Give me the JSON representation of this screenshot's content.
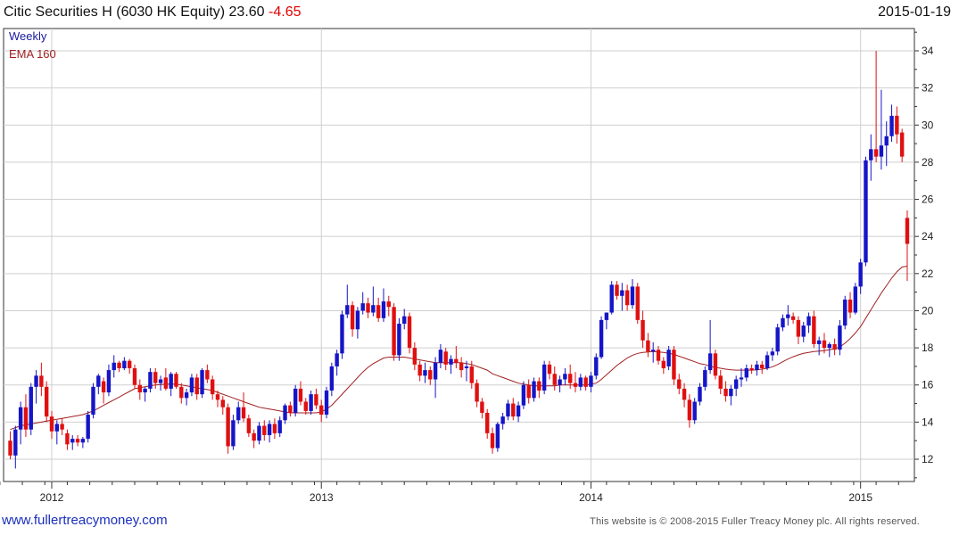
{
  "header": {
    "title": "Citic Securities H (6030 HK  Equity) 23.60",
    "change": "-4.65",
    "date": "2015-01-19"
  },
  "footer": {
    "link": "www.fullertreacymoney.com",
    "copyright": "This website is © 2008-2015 Fuller Treacy Money plc. All rights reserved."
  },
  "colors": {
    "up": "#1515c8",
    "down": "#e01010",
    "ema": "#a02020",
    "grid": "#cfcfcf",
    "axis": "#333333"
  },
  "chart_data": {
    "type": "candlestick",
    "title": "Citic Securities H (6030 HK  Equity) 23.60 -4.65",
    "frequency": "Weekly",
    "legend": [
      "Weekly",
      "EMA 160"
    ],
    "legend_position": "top-left",
    "ylim": [
      10.8,
      35.2
    ],
    "yticks": [
      12,
      14,
      16,
      18,
      20,
      22,
      24,
      26,
      28,
      30,
      32,
      34
    ],
    "y_axis_side": "right",
    "xticks": [
      {
        "label": "2012",
        "week": 8
      },
      {
        "label": "2013",
        "week": 60
      },
      {
        "label": "2014",
        "week": 112
      },
      {
        "label": "2015",
        "week": 164
      }
    ],
    "grid": true,
    "candles": [
      [
        13.0,
        13.5,
        12.0,
        12.2
      ],
      [
        12.2,
        13.8,
        11.5,
        13.6
      ],
      [
        13.6,
        15.1,
        12.8,
        14.8
      ],
      [
        14.8,
        15.5,
        13.2,
        13.6
      ],
      [
        13.6,
        16.1,
        13.3,
        15.9
      ],
      [
        15.9,
        16.8,
        15.0,
        16.5
      ],
      [
        16.5,
        17.2,
        15.4,
        15.9
      ],
      [
        15.9,
        16.2,
        14.0,
        14.3
      ],
      [
        14.3,
        14.6,
        13.1,
        13.5
      ],
      [
        13.5,
        14.1,
        12.8,
        13.9
      ],
      [
        13.9,
        14.2,
        13.3,
        13.6
      ],
      [
        13.4,
        13.6,
        12.5,
        12.8
      ],
      [
        12.9,
        13.3,
        12.5,
        13.1
      ],
      [
        13.1,
        13.3,
        12.7,
        12.9
      ],
      [
        12.9,
        13.2,
        12.6,
        13.1
      ],
      [
        13.1,
        14.6,
        12.9,
        14.4
      ],
      [
        14.4,
        16.1,
        14.2,
        15.9
      ],
      [
        15.9,
        16.6,
        15.5,
        16.5
      ],
      [
        16.2,
        16.4,
        15.0,
        15.6
      ],
      [
        15.6,
        17.1,
        15.4,
        16.8
      ],
      [
        16.8,
        17.6,
        16.4,
        17.2
      ],
      [
        17.2,
        17.3,
        16.7,
        16.9
      ],
      [
        16.9,
        17.5,
        16.8,
        17.3
      ],
      [
        17.3,
        17.4,
        16.6,
        16.9
      ],
      [
        16.9,
        17.1,
        15.8,
        16.0
      ],
      [
        16.0,
        16.3,
        15.2,
        15.6
      ],
      [
        15.6,
        15.9,
        15.1,
        15.8
      ],
      [
        15.8,
        16.9,
        15.6,
        16.7
      ],
      [
        16.7,
        16.9,
        15.8,
        16.1
      ],
      [
        16.1,
        16.5,
        15.7,
        16.3
      ],
      [
        16.4,
        16.9,
        15.7,
        15.8
      ],
      [
        15.8,
        16.7,
        15.4,
        16.6
      ],
      [
        16.6,
        16.7,
        15.8,
        15.9
      ],
      [
        15.9,
        16.1,
        15.0,
        15.3
      ],
      [
        15.3,
        15.8,
        14.9,
        15.6
      ],
      [
        15.6,
        16.6,
        15.4,
        16.4
      ],
      [
        16.4,
        16.6,
        15.2,
        15.5
      ],
      [
        15.5,
        16.9,
        15.3,
        16.8
      ],
      [
        16.8,
        17.1,
        16.1,
        16.3
      ],
      [
        16.3,
        16.5,
        15.2,
        15.5
      ],
      [
        15.5,
        15.7,
        14.8,
        15.2
      ],
      [
        15.2,
        15.4,
        14.4,
        14.8
      ],
      [
        14.8,
        15.0,
        12.3,
        12.7
      ],
      [
        12.7,
        14.4,
        12.5,
        14.1
      ],
      [
        14.1,
        15.1,
        13.9,
        14.8
      ],
      [
        14.8,
        15.6,
        14.0,
        14.2
      ],
      [
        14.2,
        14.4,
        13.2,
        13.4
      ],
      [
        13.4,
        13.6,
        12.6,
        13.0
      ],
      [
        13.0,
        14.0,
        12.8,
        13.8
      ],
      [
        13.8,
        14.1,
        13.0,
        13.3
      ],
      [
        13.3,
        14.1,
        12.9,
        13.9
      ],
      [
        13.9,
        14.2,
        13.1,
        13.4
      ],
      [
        13.4,
        14.3,
        13.2,
        14.1
      ],
      [
        14.1,
        15.0,
        13.9,
        14.9
      ],
      [
        14.9,
        15.1,
        14.3,
        14.5
      ],
      [
        14.5,
        16.0,
        14.3,
        15.8
      ],
      [
        15.8,
        16.2,
        14.9,
        15.1
      ],
      [
        15.1,
        15.3,
        14.4,
        14.6
      ],
      [
        14.6,
        15.7,
        14.4,
        15.5
      ],
      [
        15.5,
        15.8,
        14.7,
        14.9
      ],
      [
        14.9,
        15.2,
        14.0,
        14.4
      ],
      [
        14.4,
        15.9,
        14.2,
        15.7
      ],
      [
        15.7,
        17.2,
        15.4,
        17.0
      ],
      [
        17.0,
        17.9,
        16.5,
        17.7
      ],
      [
        17.7,
        20.0,
        17.4,
        19.8
      ],
      [
        19.8,
        21.4,
        19.6,
        20.3
      ],
      [
        20.3,
        20.5,
        18.6,
        19.0
      ],
      [
        19.0,
        20.2,
        18.5,
        20.0
      ],
      [
        20.0,
        21.0,
        19.8,
        20.4
      ],
      [
        20.4,
        20.7,
        19.6,
        19.9
      ],
      [
        19.9,
        21.3,
        19.7,
        20.3
      ],
      [
        20.3,
        20.7,
        19.4,
        19.6
      ],
      [
        19.6,
        21.2,
        19.4,
        20.5
      ],
      [
        20.5,
        20.8,
        19.7,
        20.2
      ],
      [
        20.2,
        20.4,
        17.3,
        17.6
      ],
      [
        17.6,
        19.6,
        17.3,
        19.3
      ],
      [
        19.3,
        20.1,
        19.0,
        19.7
      ],
      [
        19.7,
        19.9,
        17.7,
        18.0
      ],
      [
        18.0,
        18.3,
        16.8,
        17.1
      ],
      [
        17.1,
        17.3,
        16.2,
        16.5
      ],
      [
        16.5,
        17.2,
        16.1,
        16.8
      ],
      [
        16.8,
        17.0,
        16.0,
        16.3
      ],
      [
        16.3,
        17.5,
        15.3,
        17.2
      ],
      [
        17.2,
        18.2,
        16.9,
        17.9
      ],
      [
        17.8,
        18.0,
        16.8,
        17.1
      ],
      [
        17.1,
        17.6,
        16.6,
        17.4
      ],
      [
        17.4,
        18.1,
        16.9,
        17.2
      ],
      [
        17.2,
        17.5,
        16.4,
        16.8
      ],
      [
        16.9,
        17.3,
        16.2,
        17.0
      ],
      [
        17.0,
        17.3,
        15.8,
        16.1
      ],
      [
        16.1,
        16.3,
        14.8,
        15.1
      ],
      [
        15.1,
        15.3,
        14.2,
        14.5
      ],
      [
        14.5,
        14.7,
        13.1,
        13.4
      ],
      [
        13.4,
        13.7,
        12.3,
        12.6
      ],
      [
        12.6,
        14.0,
        12.4,
        13.9
      ],
      [
        13.9,
        14.5,
        13.6,
        14.3
      ],
      [
        14.3,
        15.2,
        14.1,
        15.0
      ],
      [
        15.0,
        15.3,
        14.1,
        14.3
      ],
      [
        14.3,
        15.1,
        14.0,
        14.9
      ],
      [
        14.9,
        16.2,
        14.7,
        16.0
      ],
      [
        16.0,
        16.3,
        15.0,
        15.3
      ],
      [
        15.3,
        16.4,
        15.1,
        16.2
      ],
      [
        16.2,
        16.4,
        15.3,
        15.7
      ],
      [
        15.7,
        17.3,
        15.5,
        17.1
      ],
      [
        17.1,
        17.3,
        16.3,
        16.6
      ],
      [
        16.6,
        17.0,
        15.7,
        16.0
      ],
      [
        16.0,
        16.5,
        15.6,
        16.3
      ],
      [
        16.3,
        16.9,
        16.0,
        16.6
      ],
      [
        16.6,
        17.1,
        15.8,
        16.1
      ],
      [
        16.1,
        16.7,
        15.6,
        15.9
      ],
      [
        15.9,
        16.6,
        15.7,
        16.4
      ],
      [
        16.4,
        16.5,
        15.7,
        15.9
      ],
      [
        15.9,
        16.7,
        15.6,
        16.5
      ],
      [
        16.5,
        17.7,
        16.3,
        17.5
      ],
      [
        17.5,
        19.7,
        17.4,
        19.5
      ],
      [
        19.5,
        19.9,
        19.0,
        19.9
      ],
      [
        19.9,
        21.6,
        19.8,
        21.4
      ],
      [
        21.4,
        21.6,
        20.6,
        20.8
      ],
      [
        20.8,
        21.5,
        20.0,
        21.1
      ],
      [
        21.1,
        21.4,
        20.0,
        20.3
      ],
      [
        20.3,
        21.7,
        20.1,
        21.3
      ],
      [
        21.3,
        21.5,
        19.3,
        19.5
      ],
      [
        19.5,
        20.0,
        18.0,
        18.4
      ],
      [
        18.4,
        18.8,
        17.5,
        17.8
      ],
      [
        17.8,
        18.3,
        17.2,
        17.9
      ],
      [
        17.9,
        18.1,
        17.1,
        17.3
      ],
      [
        17.3,
        17.5,
        16.6,
        16.9
      ],
      [
        17.0,
        18.1,
        16.8,
        17.9
      ],
      [
        17.9,
        18.1,
        16.0,
        16.3
      ],
      [
        16.3,
        16.6,
        15.5,
        15.8
      ],
      [
        15.8,
        16.1,
        14.8,
        15.2
      ],
      [
        15.2,
        15.5,
        13.7,
        14.1
      ],
      [
        14.1,
        15.3,
        13.9,
        15.1
      ],
      [
        15.1,
        16.1,
        14.9,
        15.9
      ],
      [
        15.9,
        17.0,
        15.7,
        16.8
      ],
      [
        16.8,
        19.5,
        16.6,
        17.7
      ],
      [
        17.7,
        17.9,
        16.3,
        16.5
      ],
      [
        16.5,
        16.8,
        15.5,
        15.8
      ],
      [
        15.8,
        16.2,
        15.1,
        15.4
      ],
      [
        15.4,
        16.0,
        14.9,
        15.8
      ],
      [
        15.8,
        16.5,
        15.4,
        16.3
      ],
      [
        16.3,
        16.9,
        15.9,
        16.4
      ],
      [
        16.4,
        17.1,
        16.2,
        16.9
      ],
      [
        16.9,
        17.1,
        16.6,
        16.8
      ],
      [
        16.8,
        17.3,
        16.5,
        17.1
      ],
      [
        17.1,
        17.3,
        16.6,
        16.9
      ],
      [
        16.9,
        17.8,
        16.8,
        17.6
      ],
      [
        17.6,
        18.0,
        17.3,
        17.8
      ],
      [
        17.8,
        19.3,
        17.6,
        19.1
      ],
      [
        19.1,
        19.8,
        18.9,
        19.6
      ],
      [
        19.6,
        20.3,
        19.2,
        19.8
      ],
      [
        19.7,
        19.9,
        19.3,
        19.5
      ],
      [
        19.5,
        19.7,
        18.2,
        18.6
      ],
      [
        18.6,
        19.4,
        18.3,
        19.2
      ],
      [
        19.2,
        19.9,
        18.8,
        19.7
      ],
      [
        19.7,
        20.0,
        18.0,
        18.2
      ],
      [
        18.2,
        18.6,
        17.6,
        18.4
      ],
      [
        18.4,
        18.8,
        17.7,
        18.0
      ],
      [
        18.0,
        18.3,
        17.5,
        18.2
      ],
      [
        18.2,
        18.5,
        17.6,
        17.9
      ],
      [
        17.9,
        19.5,
        17.6,
        19.2
      ],
      [
        19.2,
        20.8,
        19.0,
        20.6
      ],
      [
        20.6,
        21.0,
        19.6,
        19.9
      ],
      [
        19.9,
        21.5,
        19.8,
        21.3
      ],
      [
        21.3,
        22.8,
        20.9,
        22.6
      ],
      [
        22.6,
        28.3,
        22.4,
        28.1
      ],
      [
        28.1,
        29.5,
        27.0,
        28.7
      ],
      [
        28.7,
        34.0,
        28.0,
        28.3
      ],
      [
        28.3,
        31.9,
        27.6,
        28.9
      ],
      [
        28.9,
        30.2,
        27.8,
        29.4
      ],
      [
        29.4,
        31.1,
        29.1,
        30.5
      ],
      [
        30.5,
        31.0,
        29.0,
        29.5
      ],
      [
        29.6,
        29.8,
        28.0,
        28.3
      ],
      [
        25.0,
        25.4,
        21.6,
        23.6
      ]
    ],
    "ema_160": [
      13.6,
      13.7,
      13.8,
      13.85,
      13.9,
      13.95,
      14.0,
      14.05,
      14.1,
      14.15,
      14.2,
      14.25,
      14.3,
      14.35,
      14.4,
      14.5,
      14.6,
      14.75,
      14.9,
      15.05,
      15.2,
      15.35,
      15.5,
      15.65,
      15.8,
      15.85,
      15.9,
      15.95,
      16.0,
      16.02,
      16.04,
      16.05,
      16.05,
      16.0,
      15.95,
      15.9,
      15.85,
      15.8,
      15.75,
      15.7,
      15.6,
      15.5,
      15.4,
      15.3,
      15.2,
      15.1,
      15.0,
      14.9,
      14.8,
      14.75,
      14.7,
      14.65,
      14.6,
      14.55,
      14.5,
      14.5,
      14.5,
      14.5,
      14.5,
      14.5,
      14.55,
      14.7,
      14.9,
      15.2,
      15.5,
      15.8,
      16.1,
      16.4,
      16.7,
      16.95,
      17.15,
      17.3,
      17.45,
      17.5,
      17.5,
      17.5,
      17.5,
      17.45,
      17.4,
      17.35,
      17.3,
      17.25,
      17.2,
      17.2,
      17.2,
      17.2,
      17.2,
      17.2,
      17.15,
      17.1,
      17.0,
      16.9,
      16.8,
      16.6,
      16.5,
      16.4,
      16.3,
      16.2,
      16.1,
      16.05,
      16.0,
      15.95,
      15.95,
      15.95,
      15.95,
      15.95,
      16.0,
      16.0,
      16.0,
      16.0,
      16.0,
      16.0,
      16.05,
      16.1,
      16.3,
      16.55,
      16.8,
      17.05,
      17.25,
      17.45,
      17.6,
      17.7,
      17.75,
      17.78,
      17.8,
      17.78,
      17.75,
      17.7,
      17.65,
      17.55,
      17.45,
      17.35,
      17.25,
      17.15,
      17.1,
      17.0,
      16.95,
      16.9,
      16.85,
      16.82,
      16.8,
      16.8,
      16.8,
      16.8,
      16.82,
      16.85,
      16.9,
      16.98,
      17.1,
      17.25,
      17.4,
      17.52,
      17.62,
      17.7,
      17.75,
      17.8,
      17.82,
      17.85,
      17.9,
      17.95,
      18.05,
      18.25,
      18.5,
      18.8,
      19.15,
      19.6,
      20.05,
      20.5,
      20.95,
      21.35,
      21.75,
      22.1,
      22.35,
      22.4
    ]
  }
}
